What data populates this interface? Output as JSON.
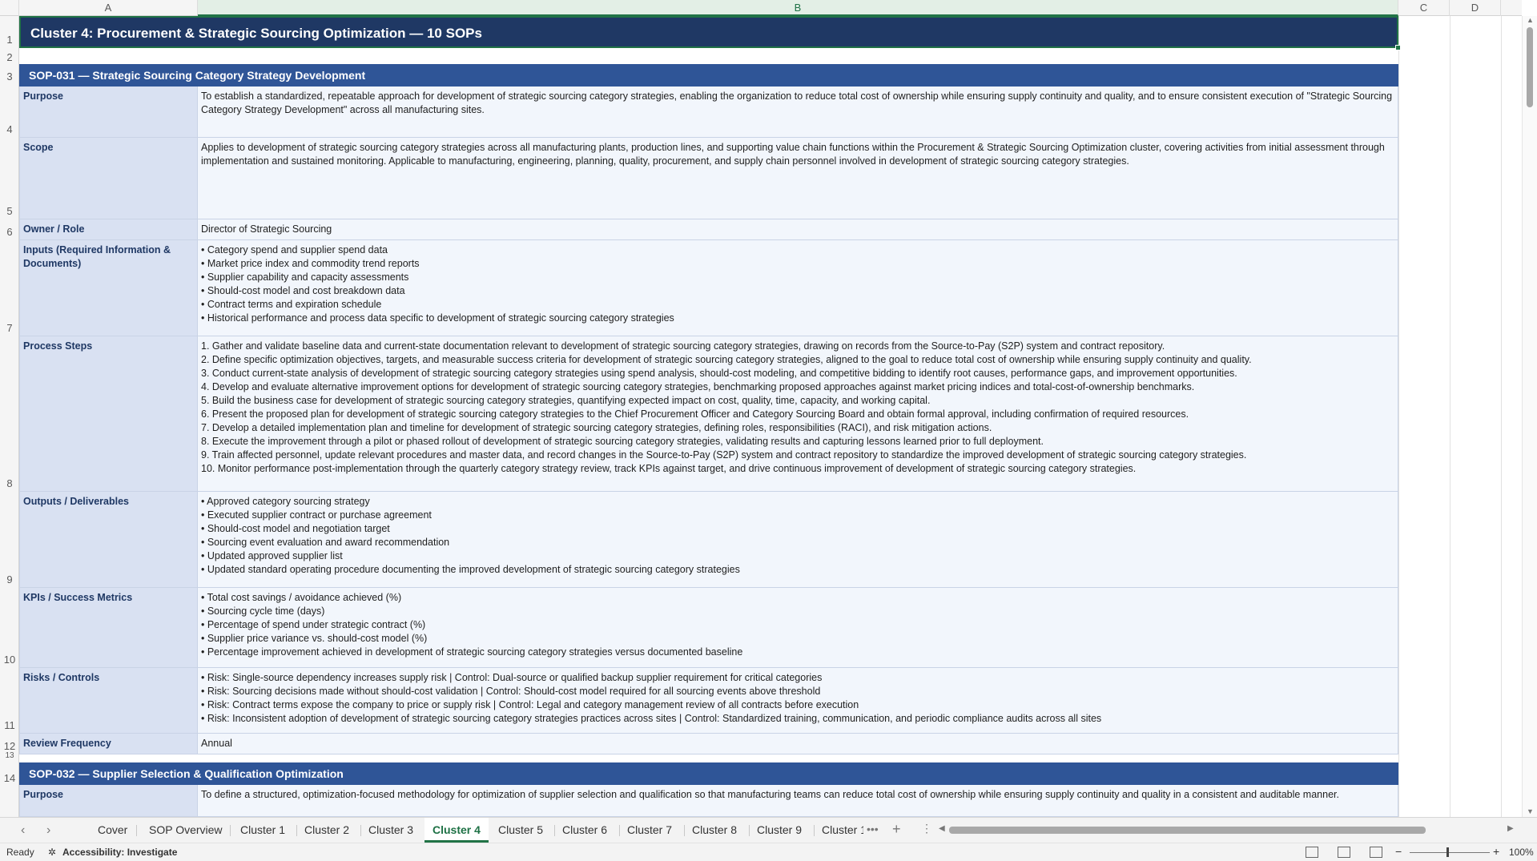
{
  "columns": [
    "A",
    "B",
    "C",
    "D"
  ],
  "row_numbers": [
    "1",
    "2",
    "3",
    "4",
    "5",
    "6",
    "7",
    "8",
    "9",
    "10",
    "11",
    "12",
    "13",
    "14"
  ],
  "cluster_title": "Cluster 4: Procurement & Strategic Sourcing Optimization  —  10 SOPs",
  "sop1": {
    "header": "SOP-031  —  Strategic Sourcing Category Strategy Development",
    "purpose_label": "Purpose",
    "purpose": "To establish a standardized, repeatable approach for development of strategic sourcing category strategies, enabling the organization to reduce total cost of ownership while ensuring supply continuity and quality, and to ensure consistent execution of \"Strategic Sourcing Category Strategy Development\" across all manufacturing sites.",
    "scope_label": "Scope",
    "scope": "Applies to development of strategic sourcing category strategies across all manufacturing plants, production lines, and supporting value chain functions within the Procurement & Strategic Sourcing Optimization cluster, covering activities from initial assessment through implementation and sustained monitoring. Applicable to manufacturing, engineering, planning, quality, procurement, and supply chain personnel involved in development of strategic sourcing category strategies.",
    "owner_label": "Owner / Role",
    "owner": "Director of Strategic Sourcing",
    "inputs_label": "Inputs (Required Information & Documents)",
    "inputs": [
      "• Category spend and supplier spend data",
      "• Market price index and commodity trend reports",
      "• Supplier capability and capacity assessments",
      "• Should-cost model and cost breakdown data",
      "• Contract terms and expiration schedule",
      "• Historical performance and process data specific to development of strategic sourcing category strategies"
    ],
    "steps_label": "Process Steps",
    "steps": [
      "1. Gather and validate baseline data and current-state documentation relevant to development of strategic sourcing category strategies, drawing on records from the Source-to-Pay (S2P) system and contract repository.",
      "2. Define specific optimization objectives, targets, and measurable success criteria for development of strategic sourcing category strategies, aligned to the goal to reduce total cost of ownership while ensuring supply continuity and quality.",
      "3. Conduct current-state analysis of development of strategic sourcing category strategies using spend analysis, should-cost modeling, and competitive bidding to identify root causes, performance gaps, and improvement opportunities.",
      "4. Develop and evaluate alternative improvement options for development of strategic sourcing category strategies, benchmarking proposed approaches against market pricing indices and total-cost-of-ownership benchmarks.",
      "5. Build the business case for development of strategic sourcing category strategies, quantifying expected impact on cost, quality, time, capacity, and working capital.",
      "6. Present the proposed plan for development of strategic sourcing category strategies to the Chief Procurement Officer and Category Sourcing Board and obtain formal approval, including confirmation of required resources.",
      "7. Develop a detailed implementation plan and timeline for development of strategic sourcing category strategies, defining roles, responsibilities (RACI), and risk mitigation actions.",
      "8. Execute the improvement through a pilot or phased rollout of development of strategic sourcing category strategies, validating results and capturing lessons learned prior to full deployment.",
      "9. Train affected personnel, update relevant procedures and master data, and record changes in the Source-to-Pay (S2P) system and contract repository to standardize the improved development of strategic sourcing category strategies.",
      "10. Monitor performance post-implementation through the quarterly category strategy review, track KPIs against target, and drive continuous improvement of development of strategic sourcing category strategies."
    ],
    "outputs_label": "Outputs / Deliverables",
    "outputs": [
      "• Approved category sourcing strategy",
      "• Executed supplier contract or purchase agreement",
      "• Should-cost model and negotiation target",
      "• Sourcing event evaluation and award recommendation",
      "• Updated approved supplier list",
      "• Updated standard operating procedure documenting the improved development of strategic sourcing category strategies"
    ],
    "kpis_label": "KPIs / Success Metrics",
    "kpis": [
      "• Total cost savings / avoidance achieved (%)",
      "• Sourcing cycle time (days)",
      "• Percentage of spend under strategic contract (%)",
      "• Supplier price variance vs. should-cost model (%)",
      "• Percentage improvement achieved in development of strategic sourcing category strategies versus documented baseline"
    ],
    "risks_label": "Risks / Controls",
    "risks": [
      "• Risk: Single-source dependency increases supply risk | Control: Dual-source or qualified backup supplier requirement for critical categories",
      "• Risk: Sourcing decisions made without should-cost validation | Control: Should-cost model required for all sourcing events above threshold",
      "• Risk: Contract terms expose the company to price or supply risk | Control: Legal and category management review of all contracts before execution",
      "• Risk: Inconsistent adoption of development of strategic sourcing category strategies practices across sites | Control: Standardized training, communication, and periodic compliance audits across all sites"
    ],
    "review_label": "Review Frequency",
    "review": "Annual"
  },
  "sop2": {
    "header": "SOP-032  —  Supplier Selection & Qualification Optimization",
    "purpose_label": "Purpose",
    "purpose": "To define a structured, optimization-focused methodology for optimization of supplier selection and qualification so that manufacturing teams can reduce total cost of ownership while ensuring supply continuity and quality in a consistent and auditable manner."
  },
  "tabs": [
    "Cover",
    "SOP Overview",
    "Cluster 1",
    "Cluster 2",
    "Cluster 3",
    "Cluster 4",
    "Cluster 5",
    "Cluster 6",
    "Cluster 7",
    "Cluster 8",
    "Cluster 9",
    "Cluster 1"
  ],
  "active_tab": "Cluster 4",
  "status": {
    "ready": "Ready",
    "accessibility": "Accessibility: Investigate",
    "zoom": "100%"
  },
  "colors": {
    "cluster_header": "#1f3864",
    "sop_header": "#2f5597",
    "label_bg": "#d9e1f2",
    "value_bg": "#f2f6fc",
    "excel_green": "#217346"
  }
}
